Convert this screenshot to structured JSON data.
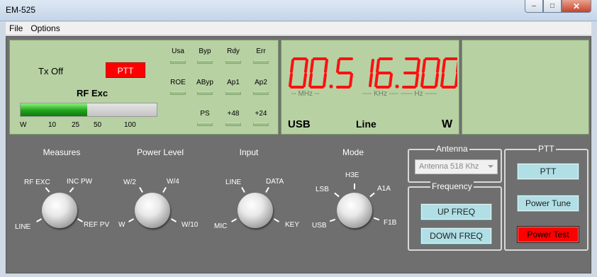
{
  "window": {
    "title": "EM-525"
  },
  "menu": {
    "file": "File",
    "options": "Options"
  },
  "status": {
    "tx_state": "Tx Off",
    "ptt_indicator": "PTT",
    "rf_label": "RF Exc",
    "rf_level_fraction": 0.49,
    "ticks": [
      "W",
      "10",
      "25",
      "50",
      "100"
    ],
    "leds_row1": [
      "Usa",
      "Byp",
      "Rdy",
      "Err"
    ],
    "leds_row2": [
      "ROE",
      "AByp",
      "Ap1",
      "Ap2"
    ],
    "leds_row3": [
      "PS",
      "+48",
      "+24"
    ]
  },
  "display": {
    "frequency": "00.516.300",
    "units": {
      "mhz": "-- MHz --",
      "khz": "---- KHz ----",
      "hz": "----- Hz -----"
    },
    "mode": "USB",
    "input": "Line",
    "power": "W",
    "color": "#ff1010"
  },
  "controls": {
    "measures": {
      "title": "Measures",
      "labels": [
        "RF EXC",
        "INC PW",
        "LINE",
        "REF PV"
      ]
    },
    "power_level": {
      "title": "Power Level",
      "labels": [
        "W/2",
        "W/4",
        "W",
        "W/10"
      ]
    },
    "input": {
      "title": "Input",
      "labels": [
        "LINE",
        "DATA",
        "MIC",
        "KEY"
      ]
    },
    "mode": {
      "title": "Mode",
      "labels": [
        "H3E",
        "LSB",
        "A1A",
        "USB",
        "F1B"
      ]
    }
  },
  "antenna": {
    "legend": "Antenna",
    "selected": "Antenna 518 Khz"
  },
  "frequency": {
    "legend": "Frequency",
    "up": "UP FREQ",
    "down": "DOWN FREQ"
  },
  "ptt": {
    "legend": "PTT",
    "ptt": "PTT",
    "power_tune": "Power Tune",
    "power_test": "Power Test"
  }
}
